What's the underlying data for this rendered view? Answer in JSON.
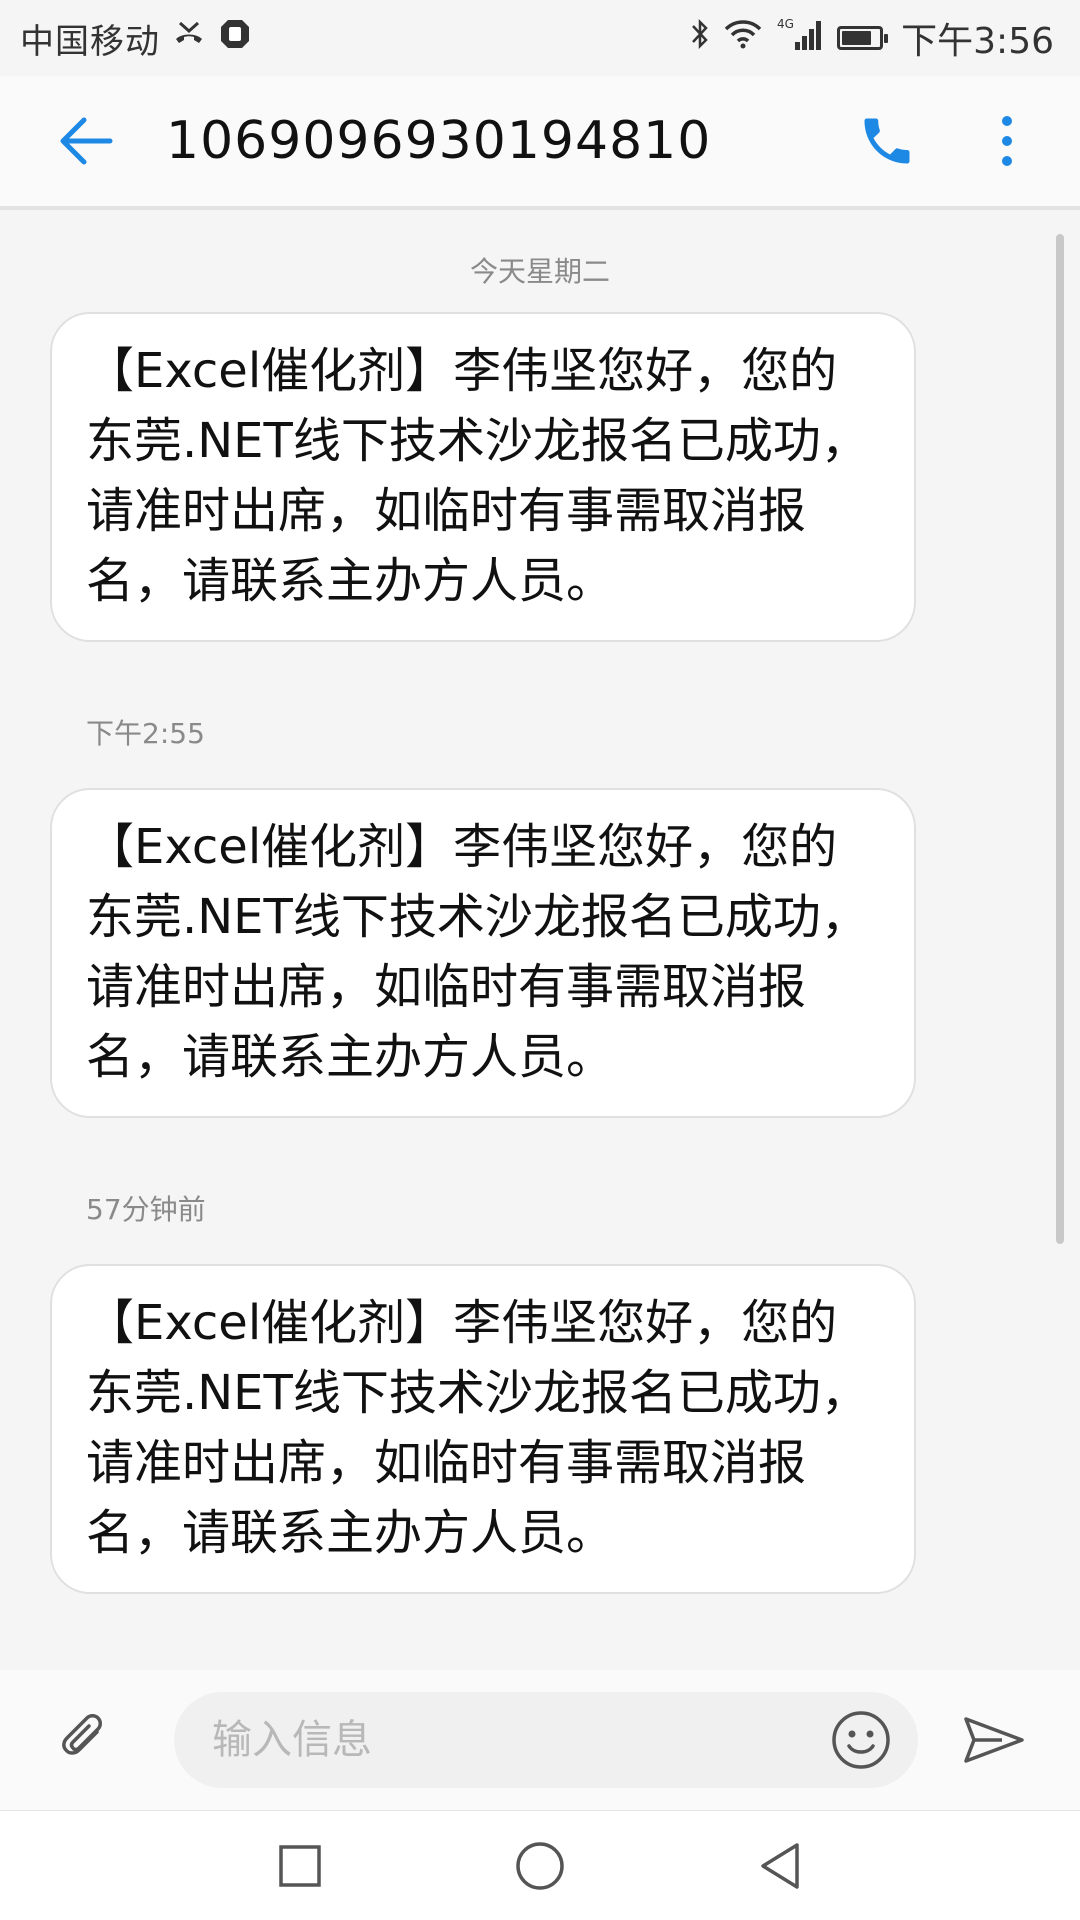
{
  "status_bar": {
    "carrier": "中国移动",
    "network": "4G",
    "time": "下午3:56",
    "battery_level": 0.8,
    "icons": [
      "missed-call-icon",
      "app-notification-icon",
      "bluetooth-icon",
      "wifi-icon",
      "signal-icon",
      "battery-icon"
    ]
  },
  "header": {
    "title": "1069096930194810",
    "icons": [
      "back-arrow-icon",
      "phone-icon",
      "more-vert-icon"
    ],
    "accent_color": "#1e88e5"
  },
  "conversation": {
    "date_separator": "今天星期二",
    "messages": [
      {
        "text": "【Excel催化剂】李伟坚您好，您的东莞.NET线下技术沙龙报名已成功，请准时出席，如临时有事需取消报名，请联系主办方人员。",
        "time": "下午2:55"
      },
      {
        "text": "【Excel催化剂】李伟坚您好，您的东莞.NET线下技术沙龙报名已成功，请准时出席，如临时有事需取消报名，请联系主办方人员。",
        "time": "57分钟前"
      },
      {
        "text": "【Excel催化剂】李伟坚您好，您的东莞.NET线下技术沙龙报名已成功，请准时出席，如临时有事需取消报名，请联系主办方人员。",
        "time": ""
      }
    ]
  },
  "composer": {
    "placeholder": "输入信息",
    "value": "",
    "icons": [
      "attachment-icon",
      "emoji-icon",
      "send-icon"
    ]
  },
  "nav_bar": {
    "icons": [
      "recents-square-icon",
      "home-circle-icon",
      "back-triangle-icon"
    ]
  }
}
